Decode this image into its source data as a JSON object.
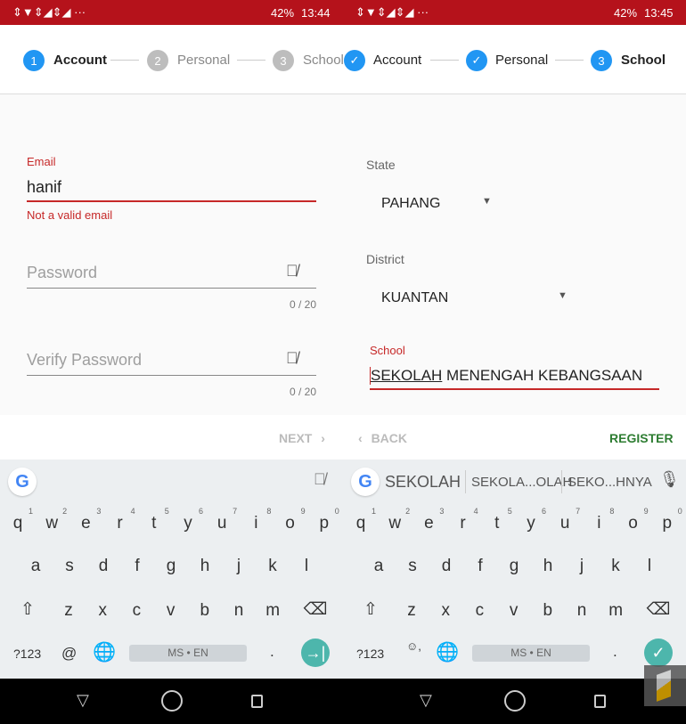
{
  "left": {
    "status": {
      "icons": "⇕▼⇕◢⇕◢ ···",
      "battery": "42%",
      "time": "13:44"
    },
    "steps": [
      {
        "num": "1",
        "label": "Account",
        "state": "active"
      },
      {
        "num": "2",
        "label": "Personal",
        "state": "inactive"
      },
      {
        "num": "3",
        "label": "School",
        "state": "inactive"
      }
    ],
    "email": {
      "label": "Email",
      "value": "hanif",
      "error": "Not a valid email"
    },
    "password": {
      "placeholder": "Password",
      "counter": "0 / 20"
    },
    "verify": {
      "placeholder": "Verify Password",
      "counter": "0 / 20"
    },
    "next_label": "NEXT",
    "suggestions": [],
    "bottom": {
      "sym": "?123",
      "extra": "@",
      "space": "MS • EN",
      "period": ".",
      "action": "→|"
    }
  },
  "right": {
    "status": {
      "icons": "⇕▼⇕◢⇕◢ ···",
      "battery": "42%",
      "time": "13:45"
    },
    "steps": [
      {
        "num": "✓",
        "label": "Account",
        "state": "done"
      },
      {
        "num": "✓",
        "label": "Personal",
        "state": "done"
      },
      {
        "num": "3",
        "label": "School",
        "state": "active"
      }
    ],
    "state": {
      "label": "State",
      "value": "PAHANG"
    },
    "district": {
      "label": "District",
      "value": "KUANTAN"
    },
    "school": {
      "label": "School",
      "value_underlined": "SEKOLAH",
      "value_rest": " MENENGAH KEBANGSAAN"
    },
    "back_label": "BACK",
    "register_label": "REGISTER",
    "suggestions": [
      "SEKOLAH",
      "SEKOLA...OLAH",
      "SEKO...HNYA"
    ],
    "bottom": {
      "sym": "?123",
      "extra": "☺,",
      "space": "MS • EN",
      "period": ".",
      "action": "✓"
    }
  },
  "keyboard": {
    "row1": [
      "q",
      "w",
      "e",
      "r",
      "t",
      "y",
      "u",
      "i",
      "o",
      "p"
    ],
    "row1_hints": [
      "1",
      "2",
      "3",
      "4",
      "5",
      "6",
      "7",
      "8",
      "9",
      "0"
    ],
    "row2": [
      "a",
      "s",
      "d",
      "f",
      "g",
      "h",
      "j",
      "k",
      "l"
    ],
    "row3": [
      "z",
      "x",
      "c",
      "v",
      "b",
      "n",
      "m"
    ]
  },
  "colors": {
    "status": "#b5121b",
    "accent": "#2196f3",
    "error": "#c62828",
    "register": "#2e7d32",
    "keyboard_action": "#4db6ac"
  }
}
